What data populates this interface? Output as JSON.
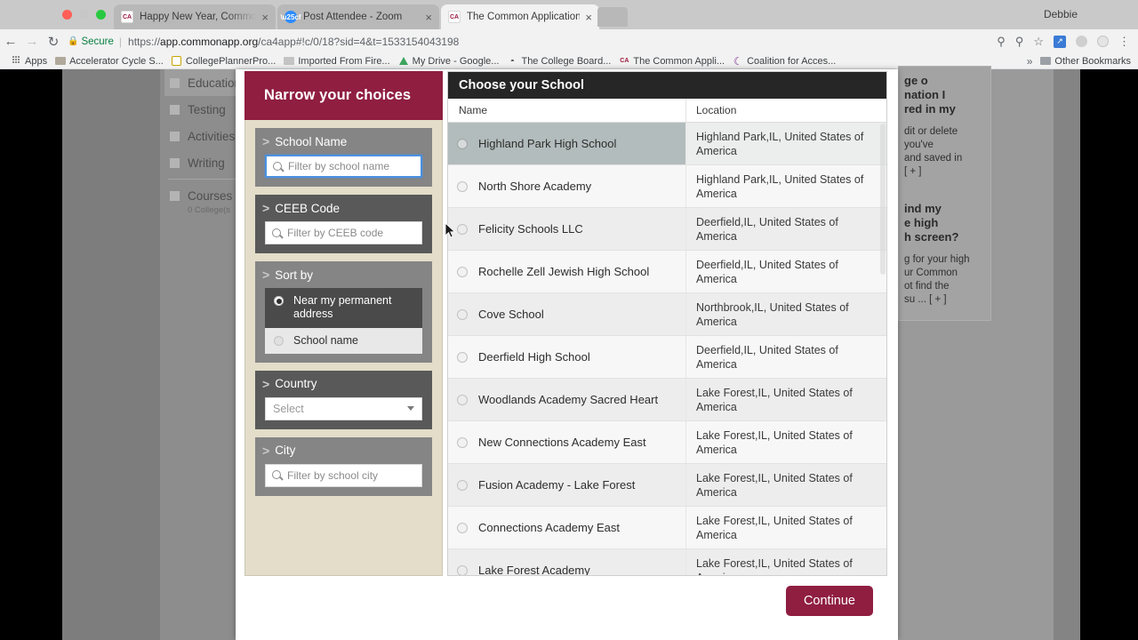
{
  "browser": {
    "tabs": [
      {
        "title": "Happy New Year, Common Ap",
        "icon": "ca-favicon",
        "active": false
      },
      {
        "title": "Post Attendee - Zoom",
        "icon": "zoom-favicon",
        "active": false
      },
      {
        "title": "The Common Application",
        "icon": "ca-favicon",
        "active": true
      }
    ],
    "close_glyph": "×",
    "profile_name": "Debbie",
    "nav": {
      "back": "←",
      "forward": "→",
      "reload": "↻"
    },
    "omnibox": {
      "secure_label": "Secure",
      "lock_icon": "lock-icon",
      "separator": "|",
      "url_prefix": "https://",
      "url_host": "app.commonapp.org",
      "url_path": "/ca4app#!c/0/18?sid=4&t=1533154043198"
    },
    "toolbar_icons": [
      "key-icon",
      "zoom-magnifier-icon",
      "bookmark-star-icon",
      "extension-blue-icon",
      "extension-grey-icon",
      "extension-circle-icon",
      "chrome-menu-icon"
    ],
    "bookmarks": [
      {
        "label": "Apps",
        "icon": "apps-grid-icon"
      },
      {
        "label": "Accelerator Cycle S...",
        "icon": "folder-icon"
      },
      {
        "label": "CollegePlannerPro...",
        "icon": "site-favicon"
      },
      {
        "label": "Imported From Fire...",
        "icon": "folder-icon"
      },
      {
        "label": "My Drive - Google...",
        "icon": "drive-icon"
      },
      {
        "label": "The College Board...",
        "icon": "collegeboard-icon"
      },
      {
        "label": "The Common Appli...",
        "icon": "ca-favicon"
      },
      {
        "label": "Coalition for Acces...",
        "icon": "coalition-icon"
      }
    ],
    "overflow_glyph": "»",
    "other_bookmarks": "Other Bookmarks"
  },
  "background_nav": {
    "items": [
      {
        "label": "Education",
        "selected": true
      },
      {
        "label": "Testing",
        "selected": false
      },
      {
        "label": "Activities",
        "selected": false
      },
      {
        "label": "Writing",
        "selected": false
      }
    ],
    "courses_label": "Courses",
    "courses_sub": "0 College(s"
  },
  "help_panel": {
    "heading_1_line1": "ge o",
    "heading_1_line2": "nation I",
    "heading_1_line3": "red in my",
    "body_1_line1": "dit or delete",
    "body_1_line2": "you've",
    "body_1_line3": "and saved in",
    "body_1_line4": "[ + ]",
    "heading_2_line1": "ind my",
    "heading_2_line2": "e high",
    "heading_2_line3": "h screen?",
    "body_2_line1": "g for your high",
    "body_2_line2": "ur Common",
    "body_2_line3": "ot find the",
    "body_2_line4": "su ... [ + ]"
  },
  "modal": {
    "filters": {
      "title": "Narrow your choices",
      "arrow_glyph": "›",
      "groups": [
        {
          "name": "school-name",
          "label": "School Name",
          "type": "search",
          "placeholder": "Filter by school name",
          "value": "",
          "focused": true,
          "shade": "light"
        },
        {
          "name": "ceeb-code",
          "label": "CEEB Code",
          "type": "search",
          "placeholder": "Filter by CEEB code",
          "value": "",
          "focused": false,
          "shade": "dark"
        },
        {
          "name": "sort-by",
          "label": "Sort by",
          "type": "radio",
          "shade": "light",
          "options": [
            {
              "label": "Near my permanent address",
              "selected": true
            },
            {
              "label": "School name",
              "selected": false
            }
          ]
        },
        {
          "name": "country",
          "label": "Country",
          "type": "select",
          "placeholder": "Select",
          "value": "Select",
          "shade": "dark"
        },
        {
          "name": "city",
          "label": "City",
          "type": "search",
          "placeholder": "Filter by school city",
          "value": "",
          "focused": false,
          "shade": "light"
        }
      ]
    },
    "schools": {
      "title": "Choose your School",
      "columns": [
        "Name",
        "Location"
      ],
      "rows": [
        {
          "name": "Highland Park High School",
          "location": "Highland Park,IL, United States of America",
          "selected": true
        },
        {
          "name": "North Shore Academy",
          "location": "Highland Park,IL, United States of America",
          "selected": false
        },
        {
          "name": "Felicity Schools LLC",
          "location": "Deerfield,IL, United States of America",
          "selected": false
        },
        {
          "name": "Rochelle Zell Jewish High School",
          "location": "Deerfield,IL, United States of America",
          "selected": false
        },
        {
          "name": "Cove School",
          "location": "Northbrook,IL, United States of America",
          "selected": false
        },
        {
          "name": "Deerfield High School",
          "location": "Deerfield,IL, United States of America",
          "selected": false
        },
        {
          "name": "Woodlands Academy Sacred Heart",
          "location": "Lake Forest,IL, United States of America",
          "selected": false
        },
        {
          "name": "New Connections Academy East",
          "location": "Lake Forest,IL, United States of America",
          "selected": false
        },
        {
          "name": "Fusion Academy - Lake Forest",
          "location": "Lake Forest,IL, United States of America",
          "selected": false
        },
        {
          "name": "Connections Academy East",
          "location": "Lake Forest,IL, United States of America",
          "selected": false
        },
        {
          "name": "Lake Forest Academy",
          "location": "Lake Forest,IL, United States of America",
          "selected": false
        }
      ]
    },
    "continue_label": "Continue"
  },
  "colors": {
    "brand_maroon": "#8f1e41",
    "table_header_dark": "#262626",
    "filter_panel_beige": "#e3ddc9",
    "filter_group_light": "#858585",
    "filter_group_dark": "#595959",
    "selected_row": "#b3bcbc",
    "focus_blue": "#4a90e2",
    "secure_green": "#0b8043"
  }
}
